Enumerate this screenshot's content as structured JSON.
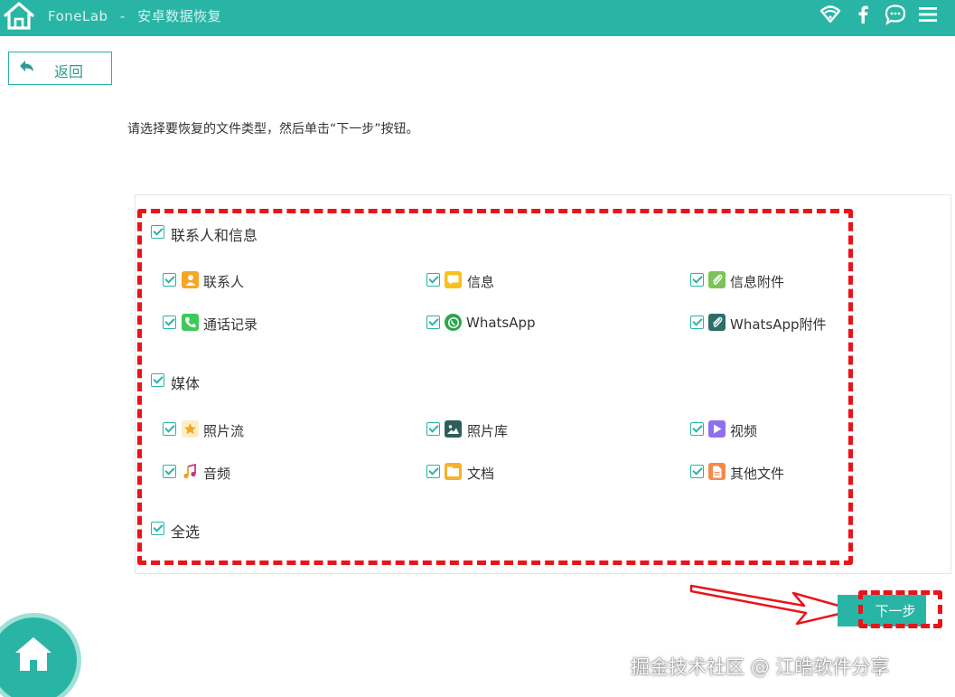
{
  "header": {
    "app_name": "FoneLab",
    "separator": "-",
    "module": "安卓数据恢复",
    "icons": [
      "home-icon",
      "wifi-icon",
      "facebook-icon",
      "chat-icon",
      "menu-icon"
    ]
  },
  "back_button": {
    "label": "返回"
  },
  "instruction": "请选择要恢复的文件类型，然后单击“下一步”按钮。",
  "groups": [
    {
      "label": "联系人和信息",
      "checked": true,
      "items": [
        {
          "label": "联系人",
          "icon": "contacts-icon",
          "checked": true
        },
        {
          "label": "信息",
          "icon": "messages-icon",
          "checked": true
        },
        {
          "label": "信息附件",
          "icon": "message-attachments-icon",
          "checked": true
        },
        {
          "label": "通话记录",
          "icon": "call-log-icon",
          "checked": true
        },
        {
          "label": "WhatsApp",
          "icon": "whatsapp-icon",
          "checked": true
        },
        {
          "label": "WhatsApp附件",
          "icon": "whatsapp-attachments-icon",
          "checked": true
        }
      ]
    },
    {
      "label": "媒体",
      "checked": true,
      "items": [
        {
          "label": "照片流",
          "icon": "photo-stream-icon",
          "checked": true
        },
        {
          "label": "照片库",
          "icon": "photo-library-icon",
          "checked": true
        },
        {
          "label": "视频",
          "icon": "video-icon",
          "checked": true
        },
        {
          "label": "音频",
          "icon": "audio-icon",
          "checked": true
        },
        {
          "label": "文档",
          "icon": "document-icon",
          "checked": true
        },
        {
          "label": "其他文件",
          "icon": "other-files-icon",
          "checked": true
        }
      ]
    }
  ],
  "select_all": {
    "label": "全选",
    "checked": true
  },
  "next_button": {
    "label": "下一步"
  },
  "watermark": "掘金技术社区 @ 江皓软件分享",
  "colors": {
    "accent": "#29b5a5",
    "highlight": "#e8141c",
    "accent_light": "#9fe0d7"
  }
}
